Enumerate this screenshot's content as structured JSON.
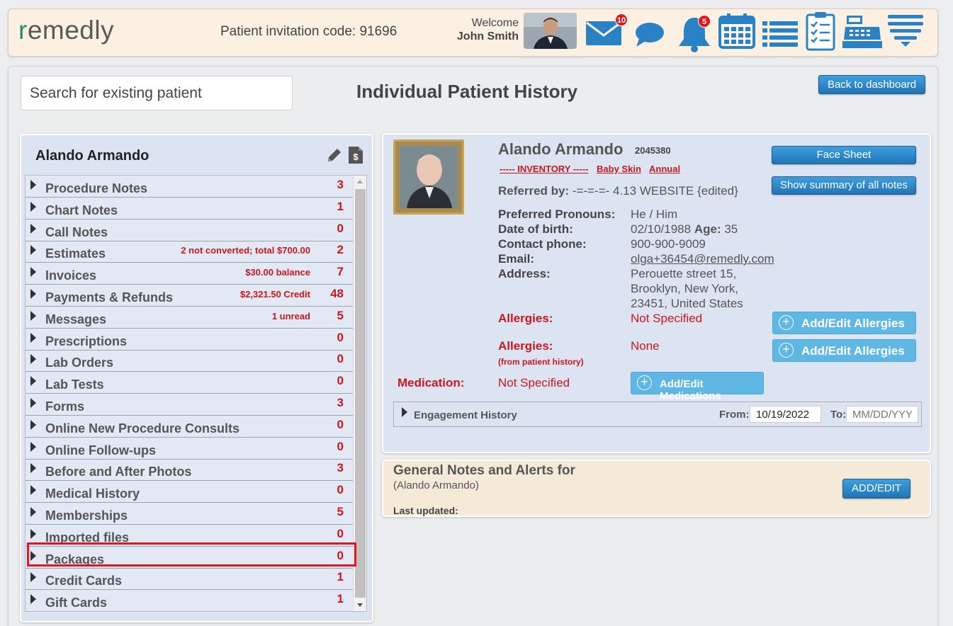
{
  "header": {
    "logo_first": "r",
    "logo_rest": "emedly",
    "invitation": "Patient invitation code: 91696",
    "welcome": "Welcome",
    "user_name": "John Smith",
    "mail_badge": "10",
    "bell_badge": "5",
    "icons": [
      "mail-icon",
      "chat-icon",
      "bell-icon",
      "calendar-icon",
      "list-icon",
      "clipboard-icon",
      "cash-register-icon",
      "menu-icon"
    ]
  },
  "search": {
    "placeholder": "Search for existing patient"
  },
  "page_title": "Individual Patient History",
  "back_button": "Back to dashboard",
  "left": {
    "patient_name": "Alando Armando",
    "items": [
      {
        "label": "Procedure Notes",
        "note": "",
        "count": "3"
      },
      {
        "label": "Chart Notes",
        "note": "",
        "count": "1"
      },
      {
        "label": "Call Notes",
        "note": "",
        "count": "0"
      },
      {
        "label": "Estimates",
        "note": "2 not converted; total $700.00",
        "count": "2"
      },
      {
        "label": "Invoices",
        "note": "$30.00 balance",
        "count": "7"
      },
      {
        "label": "Payments & Refunds",
        "note": "$2,321.50 Credit",
        "count": "48"
      },
      {
        "label": "Messages",
        "note": "1 unread",
        "count": "5"
      },
      {
        "label": "Prescriptions",
        "note": "",
        "count": "0"
      },
      {
        "label": "Lab Orders",
        "note": "",
        "count": "0"
      },
      {
        "label": "Lab Tests",
        "note": "",
        "count": "0"
      },
      {
        "label": "Forms",
        "note": "",
        "count": "3"
      },
      {
        "label": "Online New Procedure Consults",
        "note": "",
        "count": "0"
      },
      {
        "label": "Online Follow-ups",
        "note": "",
        "count": "0"
      },
      {
        "label": "Before and After Photos",
        "note": "",
        "count": "3"
      },
      {
        "label": "Medical History",
        "note": "",
        "count": "0"
      },
      {
        "label": "Memberships",
        "note": "",
        "count": "5"
      },
      {
        "label": "Imported files",
        "note": "",
        "count": "0"
      },
      {
        "label": "Packages",
        "note": "",
        "count": "0"
      },
      {
        "label": "Credit Cards",
        "note": "",
        "count": "1"
      },
      {
        "label": "Gift Cards",
        "note": "",
        "count": "1"
      }
    ]
  },
  "patient": {
    "name": "Alando Armando",
    "id": "2045380",
    "tags": [
      "----- INVENTORY -----",
      "Baby Skin",
      "Annual"
    ],
    "referred_label": "Referred by:",
    "referred_value": "-=-=-=- 4.13 WEBSITE {edited}",
    "pronouns_label": "Preferred Pronouns:",
    "pronouns": "He / Him",
    "dob_label": "Date of birth:",
    "dob": "02/10/1988",
    "age_label": "Age:",
    "age": "35",
    "phone_label": "Contact phone:",
    "phone": "900-900-9009",
    "email_label": "Email:",
    "email": "olga+36454@remedly.com",
    "address_label": "Address:",
    "address_line1": "Perouette street 15,",
    "address_line2": "Brooklyn, New York,",
    "address_line3": "23451, United States",
    "allergies_label": "Allergies:",
    "allergies_value": "Not Specified",
    "allergies2_label": "Allergies:",
    "allergies2_note": "(from patient history)",
    "allergies2_value": "None",
    "medication_label": "Medication:",
    "medication_value": "Not Specified",
    "face_sheet": "Face Sheet",
    "summary": "Show summary of all notes",
    "add_allergies": "Add/Edit Allergies",
    "add_medications": "Add/Edit Medications",
    "engagement": "Engagement History",
    "from_label": "From:",
    "from_value": "10/19/2022",
    "to_label": "To:",
    "to_placeholder": "MM/DD/YYYY"
  },
  "notes": {
    "title": "General Notes and Alerts for",
    "subtitle": "(Alando Armando)",
    "last_updated": "Last updated:",
    "add_edit": "ADD/EDIT"
  }
}
